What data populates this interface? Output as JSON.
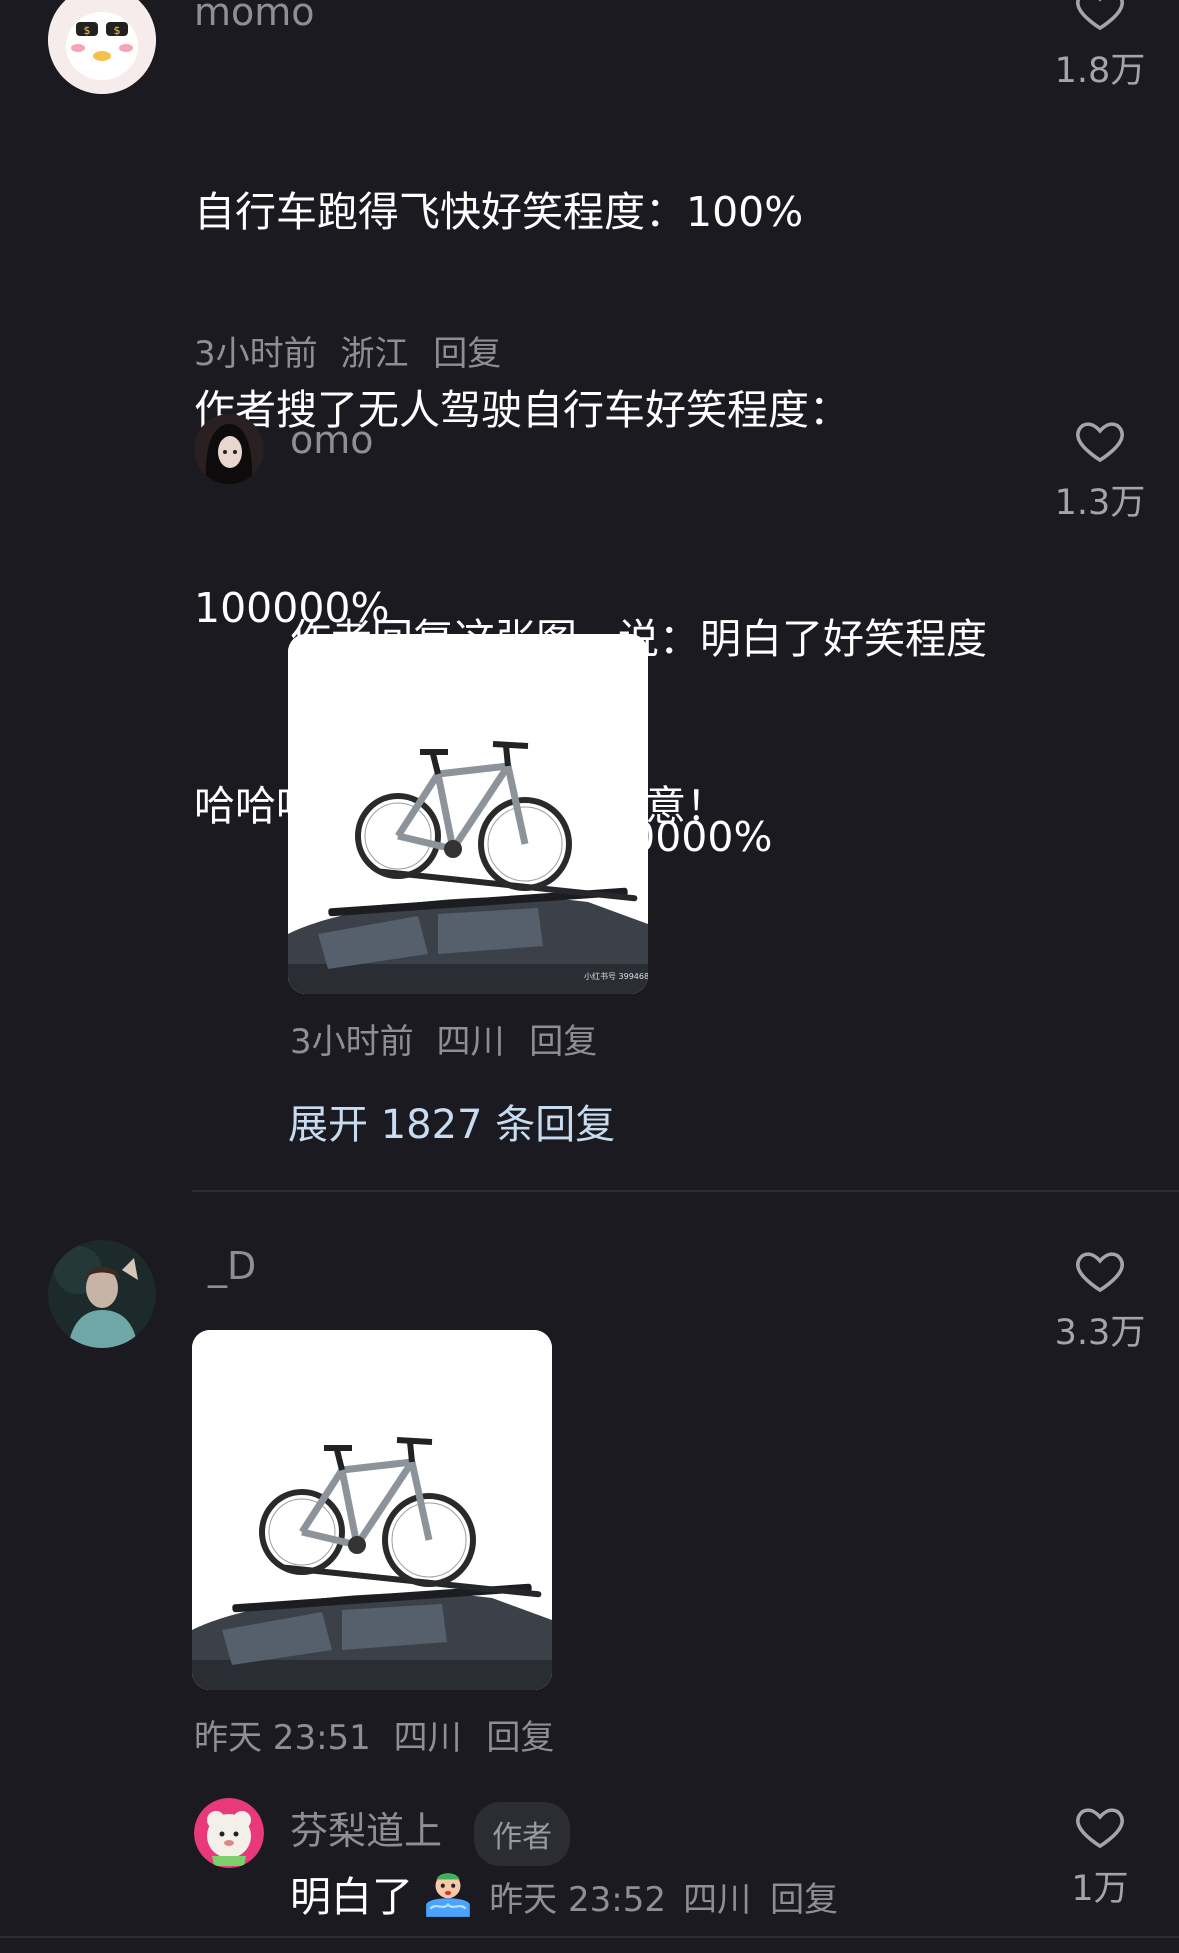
{
  "comments": [
    {
      "username": "momo",
      "lines": [
        "自行车跑得飞快好笑程度：100%",
        "作者搜了无人驾驶自行车好笑程度：",
        "100000%",
        "哈哈哈哈哈哈（无任何恶意！"
      ],
      "time": "3小时前",
      "location": "浙江",
      "reply_label": "回复",
      "likes": "1.8万"
    },
    {
      "username": "omo",
      "lines": [
        "作者回复这张图，说：明白了好笑程度",
        "10000000000000000%"
      ],
      "watermark": "小红书号 399468404",
      "time": "3小时前",
      "location": "四川",
      "reply_label": "回复",
      "likes": "1.3万",
      "expand_label": "展开 1827 条回复"
    },
    {
      "username": "_D",
      "time": "昨天 23:51",
      "location": "四川",
      "reply_label": "回复",
      "likes": "3.3万"
    },
    {
      "username": "芬梨道上",
      "badge": "作者",
      "text": "明白了",
      "emoji_icon": "crying-emoji-icon",
      "time": "昨天 23:52",
      "location": "四川",
      "reply_label": "回复",
      "likes": "1万"
    }
  ],
  "colors": {
    "background": "#1a1a20",
    "link": "#c7dcf0",
    "meta": "#8e8e96"
  }
}
